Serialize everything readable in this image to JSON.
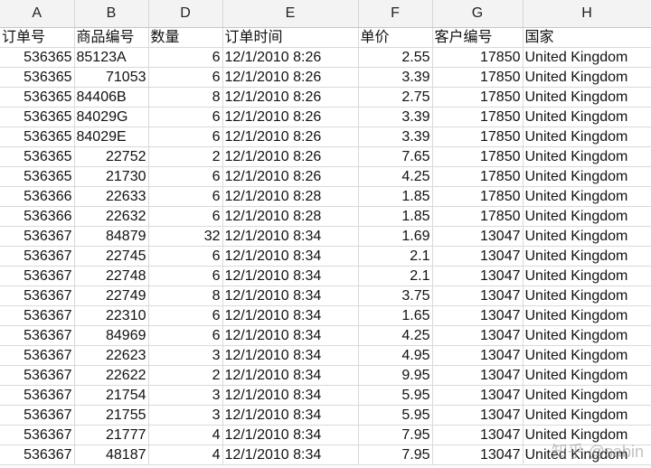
{
  "column_headers": [
    "A",
    "B",
    "D",
    "E",
    "F",
    "G",
    "H"
  ],
  "rows": [
    {
      "id": "1",
      "cells": [
        "订单号",
        "商品编号",
        "数量",
        "订单时间",
        "单价",
        "客户编号",
        "国家"
      ]
    },
    {
      "id": "2",
      "cells": [
        "536365",
        "85123A",
        "6",
        "12/1/2010 8:26",
        "2.55",
        "17850",
        "United Kingdom"
      ]
    },
    {
      "id": "3",
      "cells": [
        "536365",
        "71053",
        "6",
        "12/1/2010 8:26",
        "3.39",
        "17850",
        "United Kingdom"
      ]
    },
    {
      "id": "4",
      "cells": [
        "536365",
        "84406B",
        "8",
        "12/1/2010 8:26",
        "2.75",
        "17850",
        "United Kingdom"
      ]
    },
    {
      "id": "5",
      "cells": [
        "536365",
        "84029G",
        "6",
        "12/1/2010 8:26",
        "3.39",
        "17850",
        "United Kingdom"
      ]
    },
    {
      "id": "6",
      "cells": [
        "536365",
        "84029E",
        "6",
        "12/1/2010 8:26",
        "3.39",
        "17850",
        "United Kingdom"
      ]
    },
    {
      "id": "7",
      "cells": [
        "536365",
        "22752",
        "2",
        "12/1/2010 8:26",
        "7.65",
        "17850",
        "United Kingdom"
      ]
    },
    {
      "id": "8",
      "cells": [
        "536365",
        "21730",
        "6",
        "12/1/2010 8:26",
        "4.25",
        "17850",
        "United Kingdom"
      ]
    },
    {
      "id": "9",
      "cells": [
        "536366",
        "22633",
        "6",
        "12/1/2010 8:28",
        "1.85",
        "17850",
        "United Kingdom"
      ]
    },
    {
      "id": "10",
      "cells": [
        "536366",
        "22632",
        "6",
        "12/1/2010 8:28",
        "1.85",
        "17850",
        "United Kingdom"
      ]
    },
    {
      "id": "11",
      "cells": [
        "536367",
        "84879",
        "32",
        "12/1/2010 8:34",
        "1.69",
        "13047",
        "United Kingdom"
      ]
    },
    {
      "id": "12",
      "cells": [
        "536367",
        "22745",
        "6",
        "12/1/2010 8:34",
        "2.1",
        "13047",
        "United Kingdom"
      ]
    },
    {
      "id": "13",
      "cells": [
        "536367",
        "22748",
        "6",
        "12/1/2010 8:34",
        "2.1",
        "13047",
        "United Kingdom"
      ]
    },
    {
      "id": "14",
      "cells": [
        "536367",
        "22749",
        "8",
        "12/1/2010 8:34",
        "3.75",
        "13047",
        "United Kingdom"
      ]
    },
    {
      "id": "15",
      "cells": [
        "536367",
        "22310",
        "6",
        "12/1/2010 8:34",
        "1.65",
        "13047",
        "United Kingdom"
      ]
    },
    {
      "id": "16",
      "cells": [
        "536367",
        "84969",
        "6",
        "12/1/2010 8:34",
        "4.25",
        "13047",
        "United Kingdom"
      ]
    },
    {
      "id": "17",
      "cells": [
        "536367",
        "22623",
        "3",
        "12/1/2010 8:34",
        "4.95",
        "13047",
        "United Kingdom"
      ]
    },
    {
      "id": "18",
      "cells": [
        "536367",
        "22622",
        "2",
        "12/1/2010 8:34",
        "9.95",
        "13047",
        "United Kingdom"
      ]
    },
    {
      "id": "19",
      "cells": [
        "536367",
        "21754",
        "3",
        "12/1/2010 8:34",
        "5.95",
        "13047",
        "United Kingdom"
      ]
    },
    {
      "id": "20",
      "cells": [
        "536367",
        "21755",
        "3",
        "12/1/2010 8:34",
        "5.95",
        "13047",
        "United Kingdom"
      ]
    },
    {
      "id": "21",
      "cells": [
        "536367",
        "21777",
        "4",
        "12/1/2010 8:34",
        "7.95",
        "13047",
        "United Kingdom"
      ]
    },
    {
      "id": "22",
      "cells": [
        "536367",
        "48187",
        "4",
        "12/1/2010 8:34",
        "7.95",
        "13047",
        "United Kingdom"
      ]
    }
  ],
  "watermark": "知乎 @sabin"
}
